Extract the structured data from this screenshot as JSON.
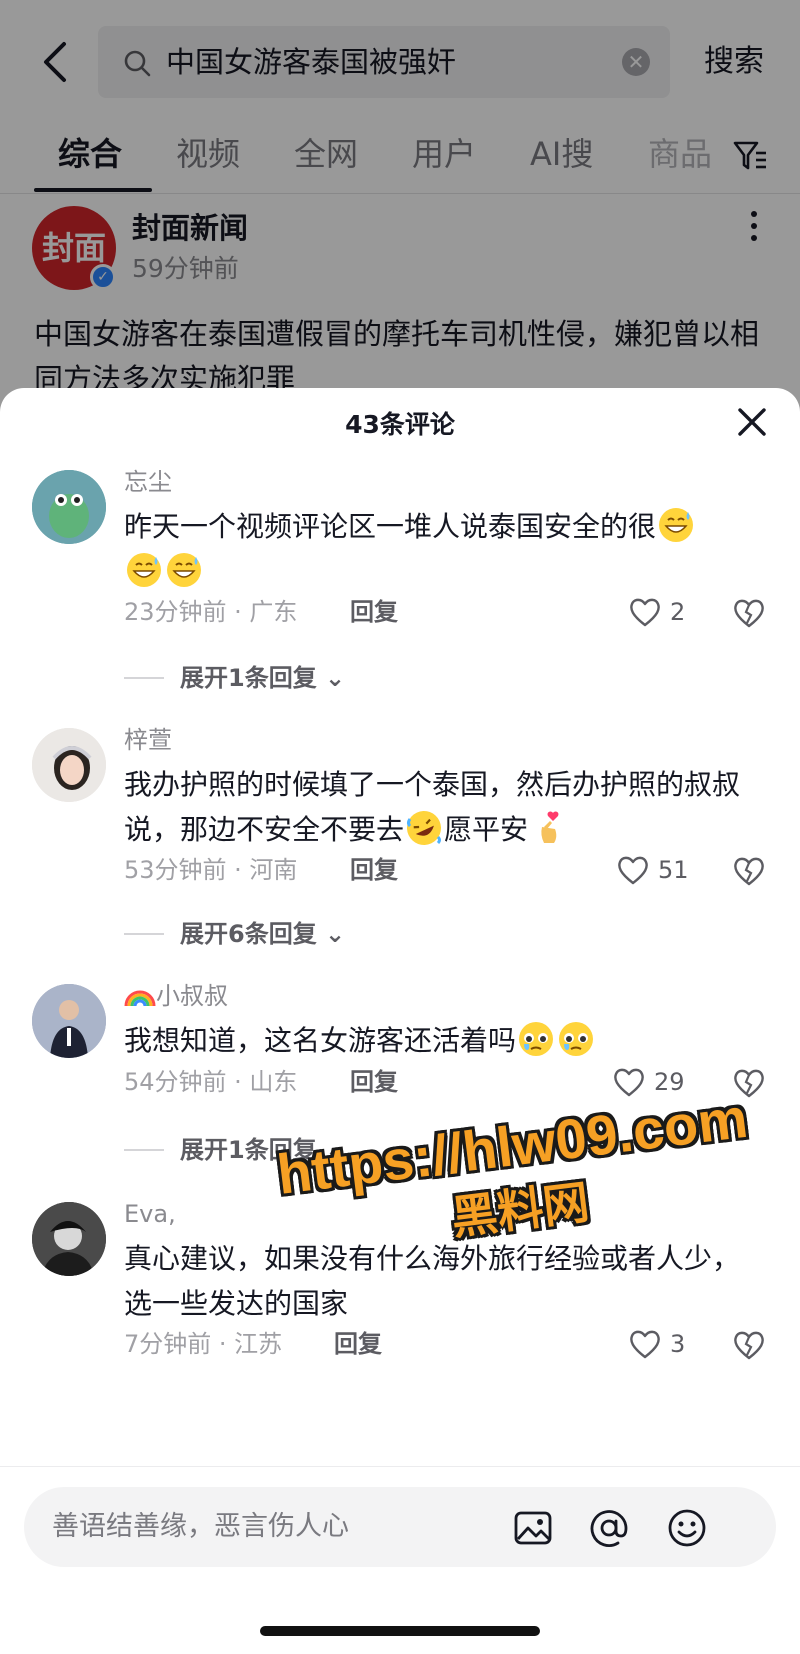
{
  "search": {
    "query": "中国女游客泰国被强奸",
    "button": "搜索"
  },
  "tabs": [
    "综合",
    "视频",
    "全网",
    "用户",
    "AI搜",
    "商品"
  ],
  "post": {
    "author": "封面新闻",
    "avatar_text": "封面",
    "time": "59分钟前",
    "text": "中国女游客在泰国遭假冒的摩托车司机性侵，嫌犯曾以相同方法多次实施犯罪"
  },
  "sheet": {
    "title": "43条评论"
  },
  "comments": [
    {
      "name": "忘尘",
      "text": "昨天一个视频评论区一堆人说泰国安全的很",
      "meta": "23分钟前 · 广东",
      "reply": "回复",
      "likes": "2",
      "expand": "展开1条回复"
    },
    {
      "name": "梓萱",
      "text_a": "我办护照的时候填了一个泰国，然后办护照的叔叔说，那边不安全不要去",
      "text_b": "愿平安",
      "meta": "53分钟前 · 河南",
      "reply": "回复",
      "likes": "51",
      "expand": "展开6条回复"
    },
    {
      "name": "小叔叔",
      "text": "我想知道，这名女游客还活着吗",
      "meta": "54分钟前 · 山东",
      "reply": "回复",
      "likes": "29",
      "expand": "展开1条回复"
    },
    {
      "name": "Eva,",
      "text": "真心建议，如果没有什么海外旅行经验或者人少，选一些发达的国家",
      "meta": "7分钟前 · 江苏",
      "reply": "回复",
      "likes": "3"
    }
  ],
  "watermark": {
    "url": "https://hlw09.com",
    "name": "黑料网"
  },
  "input": {
    "placeholder": "善语结善缘，恶言伤人心"
  },
  "icons": [
    "back-arrow-icon",
    "search-icon",
    "clear-icon",
    "filter-icon",
    "more-icon",
    "close-icon",
    "heart-icon",
    "broken-heart-icon",
    "image-icon",
    "at-icon",
    "emoji-icon"
  ]
}
